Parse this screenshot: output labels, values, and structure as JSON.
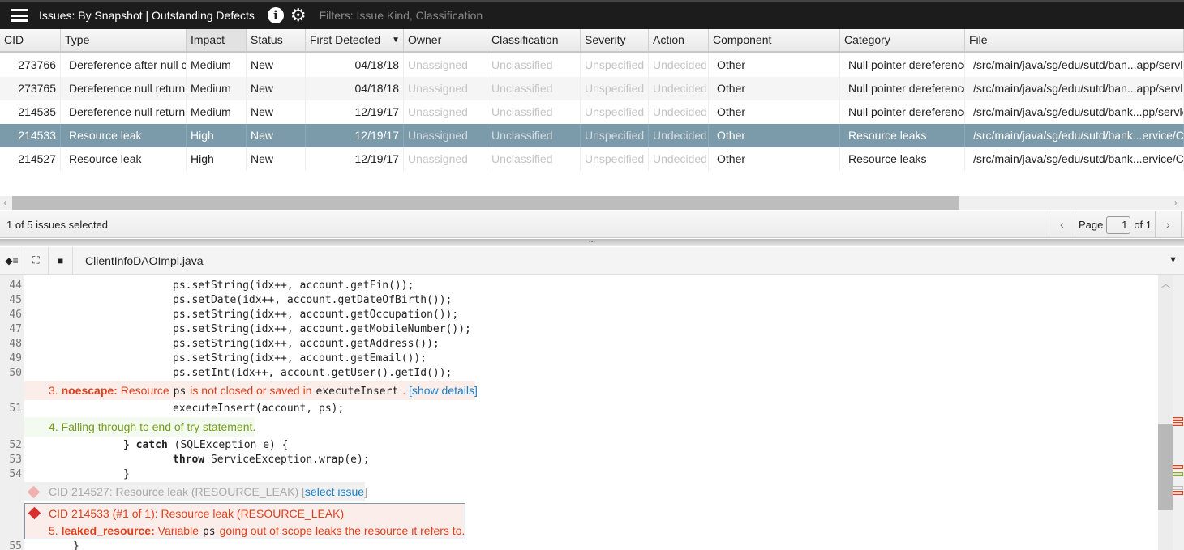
{
  "header": {
    "title": "Issues: By Snapshot | Outstanding Defects",
    "filters": "Filters: Issue Kind, Classification",
    "icons": [
      "menu-icon",
      "info-icon",
      "gear-icon"
    ]
  },
  "grid": {
    "columns": [
      "CID",
      "Type",
      "Impact",
      "Status",
      "First Detected",
      "Owner",
      "Classification",
      "Severity",
      "Action",
      "Component",
      "Category",
      "File"
    ],
    "sorted_column": "First Detected",
    "rows": [
      {
        "cid": "273766",
        "type": "Dereference after null c",
        "impact": "Medium",
        "status": "New",
        "first_detected": "04/18/18",
        "owner": "Unassigned",
        "classification": "Unclassified",
        "severity": "Unspecified",
        "action": "Undecided",
        "component": "Other",
        "category": "Null pointer dereferences",
        "file": "/src/main/java/sg/edu/sutd/ban...app/servlet"
      },
      {
        "cid": "273765",
        "type": "Dereference null return",
        "impact": "Medium",
        "status": "New",
        "first_detected": "04/18/18",
        "owner": "Unassigned",
        "classification": "Unclassified",
        "severity": "Unspecified",
        "action": "Undecided",
        "component": "Other",
        "category": "Null pointer dereferences",
        "file": "/src/main/java/sg/edu/sutd/ban...app/servlet"
      },
      {
        "cid": "214535",
        "type": "Dereference null return",
        "impact": "Medium",
        "status": "New",
        "first_detected": "12/19/17",
        "owner": "Unassigned",
        "classification": "Unclassified",
        "severity": "Unspecified",
        "action": "Undecided",
        "component": "Other",
        "category": "Null pointer dereferences",
        "file": "/src/main/java/sg/edu/sutd/bank...pp/servlet"
      },
      {
        "cid": "214533",
        "type": "Resource leak",
        "impact": "High",
        "status": "New",
        "first_detected": "12/19/17",
        "owner": "Unassigned",
        "classification": "Unclassified",
        "severity": "Unspecified",
        "action": "Undecided",
        "component": "Other",
        "category": "Resource leaks",
        "file": "/src/main/java/sg/edu/sutd/bank...ervice/C"
      },
      {
        "cid": "214527",
        "type": "Resource leak",
        "impact": "High",
        "status": "New",
        "first_detected": "12/19/17",
        "owner": "Unassigned",
        "classification": "Unclassified",
        "severity": "Unspecified",
        "action": "Undecided",
        "component": "Other",
        "category": "Resource leaks",
        "file": "/src/main/java/sg/edu/sutd/bank...ervice/C"
      }
    ],
    "selected_cid": "214533"
  },
  "status": {
    "selection": "1 of 5 issues selected",
    "page_label": "Page",
    "page": "1",
    "of_label": "of 1"
  },
  "viewer": {
    "filename": "ClientInfoDAOImpl.java",
    "lines": [
      {
        "n": "44",
        "code": "ps.setString(idx++, account.getFin());"
      },
      {
        "n": "45",
        "code": "ps.setDate(idx++, account.getDateOfBirth());"
      },
      {
        "n": "46",
        "code": "ps.setString(idx++, account.getOccupation());"
      },
      {
        "n": "47",
        "code": "ps.setString(idx++, account.getMobileNumber());"
      },
      {
        "n": "48",
        "code": "ps.setString(idx++, account.getAddress());"
      },
      {
        "n": "49",
        "code": "ps.setString(idx++, account.getEmail());"
      },
      {
        "n": "50",
        "code": "ps.setInt(idx++, account.getUser().getId());"
      },
      {
        "n": "51",
        "code": "executeInsert(account, ps);"
      },
      {
        "n": "52",
        "code_kw": "} catch",
        "code": " (SQLException e) {"
      },
      {
        "n": "53",
        "code_kw": "throw",
        "code": " ServiceException.wrap(e);"
      },
      {
        "n": "54",
        "code": "}"
      },
      {
        "n": "55",
        "code": "}"
      }
    ],
    "event3": {
      "num": "3.",
      "tag": "noescape:",
      "t1": "Resource",
      "v1": "ps",
      "t2": "is not closed or saved in",
      "v2": "executeInsert",
      "t3": ".",
      "link": "[show details]"
    },
    "event4": "4. Falling through to end of try statement.",
    "other_issue": {
      "text": "CID 214527: Resource leak (RESOURCE_LEAK)",
      "link": "select issue"
    },
    "current_issue": {
      "title": "CID 214533 (#1 of 1): Resource leak (RESOURCE_LEAK)",
      "num": "5.",
      "tag": "leaked_resource:",
      "t1": "Variable",
      "v1": "ps",
      "t2": "going out of scope leaks the resource it refers to."
    }
  },
  "colors": {
    "selected_row": "#7b9aaa",
    "event_red": "#e0401c",
    "event_green": "#7a9a1c",
    "link": "#1a7fc8"
  }
}
